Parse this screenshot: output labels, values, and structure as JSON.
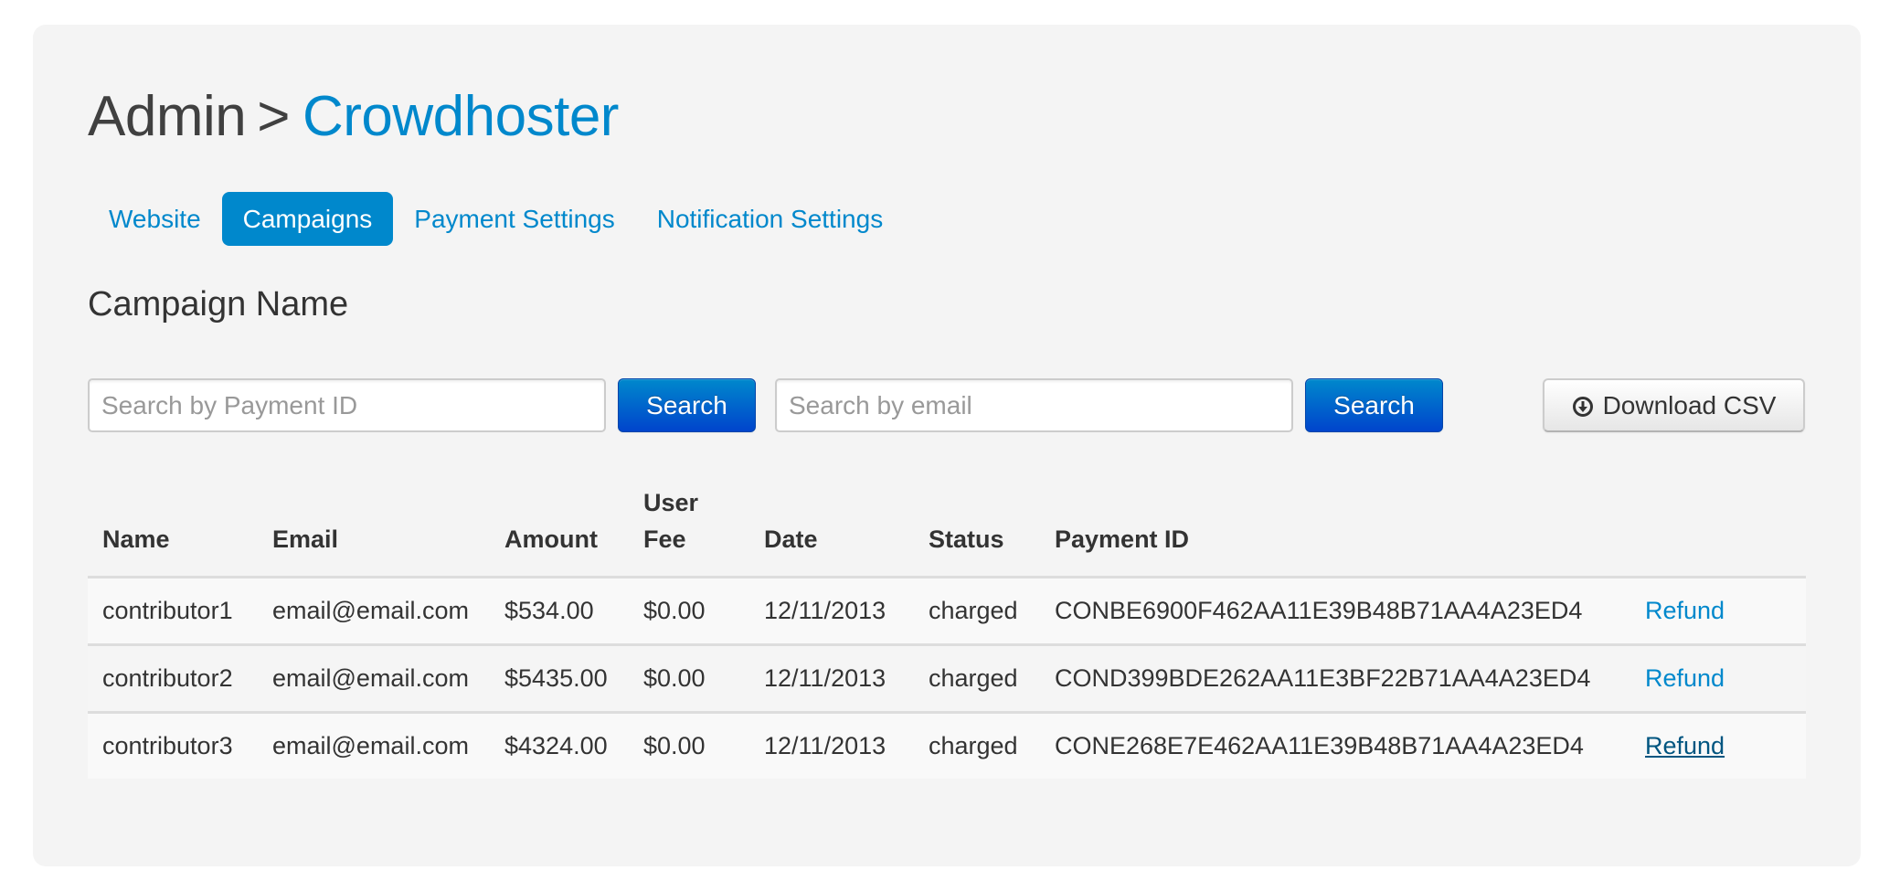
{
  "header": {
    "breadcrumb_root": "Admin",
    "breadcrumb_separator": ">",
    "breadcrumb_current": "Crowdhoster"
  },
  "tabs": [
    {
      "label": "Website",
      "active": false
    },
    {
      "label": "Campaigns",
      "active": true
    },
    {
      "label": "Payment Settings",
      "active": false
    },
    {
      "label": "Notification Settings",
      "active": false
    }
  ],
  "campaign": {
    "title": "Campaign Name"
  },
  "search": {
    "payment_id_placeholder": "Search by Payment ID",
    "payment_id_value": "",
    "payment_search_label": "Search",
    "email_placeholder": "Search by email",
    "email_value": "",
    "email_search_label": "Search",
    "download_label": "Download CSV",
    "download_icon": "circle-arrow-down-icon"
  },
  "table": {
    "headers": [
      "Name",
      "Email",
      "Amount",
      "User Fee",
      "Date",
      "Status",
      "Payment ID",
      ""
    ],
    "header_fee_line1": "User",
    "header_fee_line2": "Fee",
    "rows": [
      {
        "name": "contributor1",
        "email": "email@email.com",
        "amount": "$534.00",
        "user_fee": "$0.00",
        "date": "12/11/2013",
        "status": "charged",
        "payment_id": "CONBE6900F462AA11E39B48B71AA4A23ED4",
        "action": "Refund",
        "action_state": "normal"
      },
      {
        "name": "contributor2",
        "email": "email@email.com",
        "amount": "$5435.00",
        "user_fee": "$0.00",
        "date": "12/11/2013",
        "status": "charged",
        "payment_id": "COND399BDE262AA11E3BF22B71AA4A23ED4",
        "action": "Refund",
        "action_state": "normal"
      },
      {
        "name": "contributor3",
        "email": "email@email.com",
        "amount": "$4324.00",
        "user_fee": "$0.00",
        "date": "12/11/2013",
        "status": "charged",
        "payment_id": "CONE268E7E462AA11E39B48B71AA4A23ED4",
        "action": "Refund",
        "action_state": "hover"
      }
    ]
  },
  "colors": {
    "accent": "#0088cc",
    "link_hover": "#005580",
    "panel_bg": "#f4f4f4",
    "primary_button_top": "#0088cc",
    "primary_button_bottom": "#0044cc"
  }
}
